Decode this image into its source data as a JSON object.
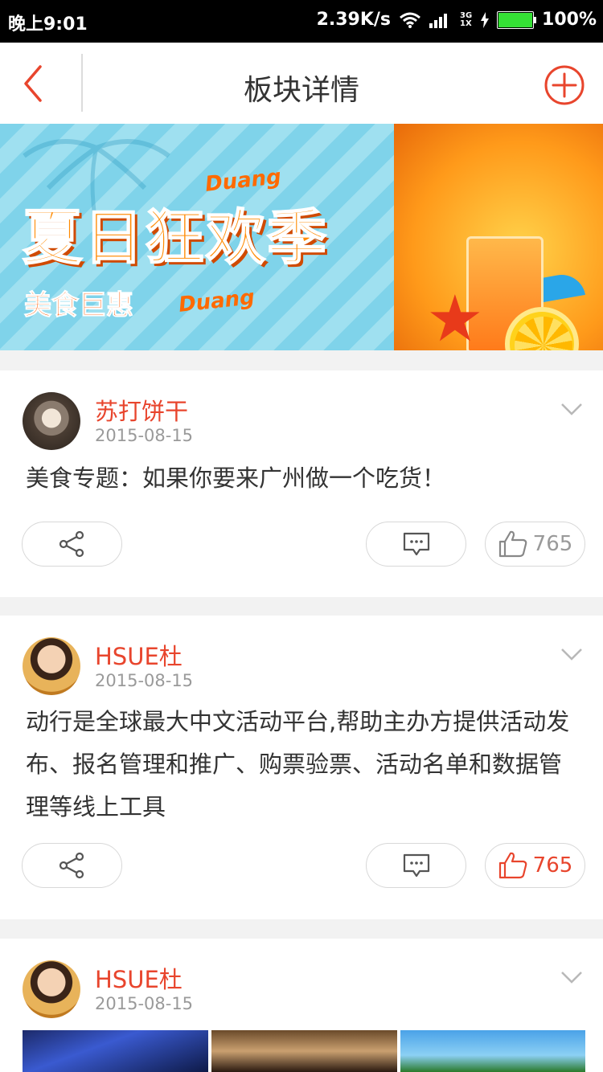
{
  "status_bar": {
    "time": "晚上9:01",
    "net_speed": "2.39K/s",
    "network_type": "3G 1X",
    "battery": "100%"
  },
  "nav": {
    "title": "板块详情",
    "back_icon": "chevron-left-icon",
    "add_icon": "plus-circle-icon"
  },
  "banner": {
    "title": "夏日狂欢季",
    "subtitle": "美食巨惠",
    "tag1": "Duang",
    "tag2": "Duang"
  },
  "posts": [
    {
      "author": "苏打饼干",
      "date": "2015-08-15",
      "content": "美食专题：如果你要来广州做一个吃货！",
      "likes": "765",
      "liked": false
    },
    {
      "author": "HSUE杜",
      "date": "2015-08-15",
      "content": "动行是全球最大中文活动平台,帮助主办方提供活动发布、报名管理和推广、购票验票、活动名单和数据管理等线上工具",
      "likes": "765",
      "liked": true
    },
    {
      "author": "HSUE杜",
      "date": "2015-08-15"
    }
  ],
  "colors": {
    "accent": "#e8452d",
    "status_bar_bg": "#000000",
    "page_bg": "#f2f2f2"
  }
}
